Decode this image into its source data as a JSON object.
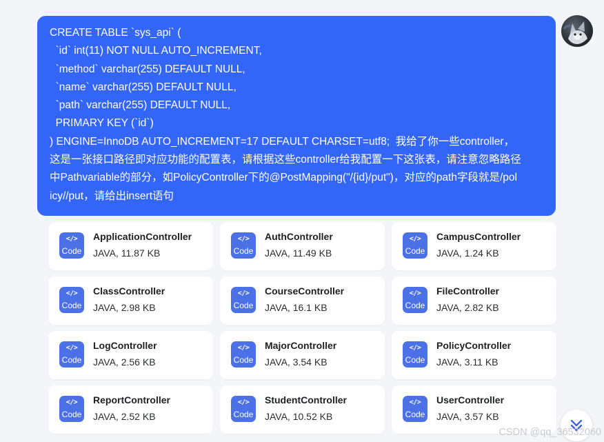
{
  "message": {
    "lines": [
      "CREATE TABLE `sys_api` (",
      "  `id` int(11) NOT NULL AUTO_INCREMENT,",
      "  `method` varchar(255) DEFAULT NULL,",
      "  `name` varchar(255) DEFAULT NULL,",
      "  `path` varchar(255) DEFAULT NULL,",
      "  PRIMARY KEY (`id`)",
      ") ENGINE=InnoDB AUTO_INCREMENT=17 DEFAULT CHARSET=utf8;  我给了你一些controller，",
      "这是一张接口路径即对应功能的配置表，请根据这些controller给我配置一下这张表，请注意忽略路径",
      "中Pathvariable的部分，如PolicyController下的@PostMapping(\"/{id}/put\")，对应的path字段就是/pol",
      "icy//put，请给出insert语句"
    ]
  },
  "file_icon": {
    "glyph": "</>",
    "type_label": "Code"
  },
  "files": [
    {
      "name": "ApplicationController",
      "meta": "JAVA, 11.87 KB"
    },
    {
      "name": "AuthController",
      "meta": "JAVA, 11.49 KB"
    },
    {
      "name": "CampusController",
      "meta": "JAVA, 1.24 KB"
    },
    {
      "name": "ClassController",
      "meta": "JAVA, 2.98 KB"
    },
    {
      "name": "CourseController",
      "meta": "JAVA, 16.1 KB"
    },
    {
      "name": "FileController",
      "meta": "JAVA, 2.82 KB"
    },
    {
      "name": "LogController",
      "meta": "JAVA, 2.56 KB"
    },
    {
      "name": "MajorController",
      "meta": "JAVA, 3.54 KB"
    },
    {
      "name": "PolicyController",
      "meta": "JAVA, 3.11 KB"
    },
    {
      "name": "ReportController",
      "meta": "JAVA, 2.52 KB"
    },
    {
      "name": "StudentController",
      "meta": "JAVA, 10.52 KB"
    },
    {
      "name": "UserController",
      "meta": "JAVA, 3.57 KB"
    }
  ],
  "watermark": "CSDN @qq_36532060",
  "colors": {
    "bubble": "#3366f6",
    "file_icon": "#4c71e6",
    "page_bg": "#f4f5f9"
  }
}
